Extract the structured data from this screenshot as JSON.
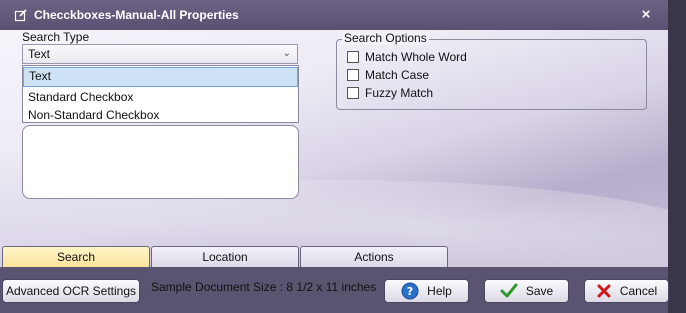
{
  "window": {
    "title": "Checckboxes-Manual-All Properties",
    "close_glyph": "×"
  },
  "search_type": {
    "label": "Search Type",
    "selected": "Text",
    "options": [
      "Text",
      "Standard Checkbox",
      "Non-Standard Checkbox"
    ]
  },
  "search_options": {
    "label": "Search Options",
    "items": [
      {
        "label": "Match Whole Word",
        "checked": false
      },
      {
        "label": "Match Case",
        "checked": false
      },
      {
        "label": "Fuzzy Match",
        "checked": false
      }
    ]
  },
  "tabs": [
    {
      "label": "Search",
      "active": true
    },
    {
      "label": "Location",
      "active": false
    },
    {
      "label": "Actions",
      "active": false
    }
  ],
  "footer": {
    "advanced_ocr_label": "Advanced OCR Settings",
    "sample_doc_size": "Sample Document Size : 8 1/2 x 11 inches",
    "help_label": "Help",
    "save_label": "Save",
    "cancel_label": "Cancel"
  },
  "icons": {
    "title": "edit-icon",
    "help": "help-icon",
    "save": "checkmark-icon",
    "cancel": "x-icon"
  },
  "colors": {
    "titlebar": "#5f5579",
    "active_tab": "#f9e39a",
    "selected_option": "#cde3f5",
    "save_check": "#2e9a2e",
    "cancel_x": "#d01818",
    "help_circle": "#2a6fc8"
  }
}
